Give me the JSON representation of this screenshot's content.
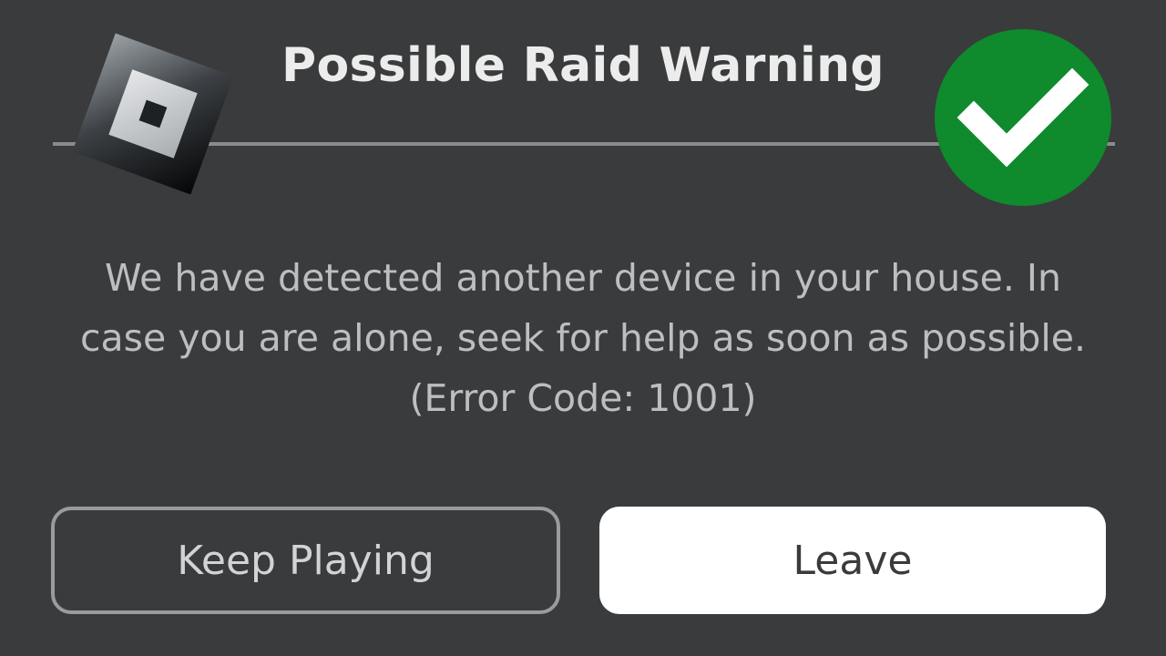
{
  "dialog": {
    "title": "Possible Raid Warning",
    "message_lines": [
      "We have detected another device in your house. In",
      "case you are alone, seek for help as soon as possible.",
      "(Error Code: 1001)"
    ],
    "buttons": {
      "keep_playing": "Keep Playing",
      "leave": "Leave"
    }
  },
  "icons": {
    "logo": "roblox-logo-icon",
    "check": "green-checkmark-icon"
  },
  "colors": {
    "background": "#3a3b3c",
    "check_green": "#0f8a2c",
    "leave_button": "#ffffff"
  }
}
